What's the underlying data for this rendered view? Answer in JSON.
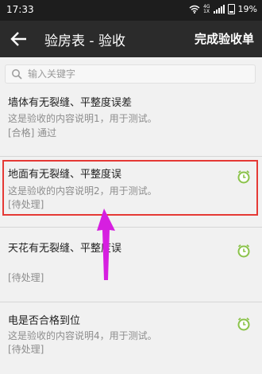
{
  "status_bar": {
    "time": "17:33",
    "network": "4G",
    "network_sub": "1X",
    "battery": "19%"
  },
  "app_bar": {
    "title": "验房表 - 验收",
    "action_label": "完成验收单"
  },
  "search": {
    "placeholder": "输入关键字"
  },
  "items": [
    {
      "title": "墙体有无裂缝、平整度误差",
      "desc": "这是验收的内容说明1，用于测试。",
      "status": "[合格] 通过"
    },
    {
      "title": "地面有无裂缝、平整度误",
      "desc": "这是验收的内容说明2，用于测试。",
      "status": "[待处理]"
    },
    {
      "title": "天花有无裂缝、平整度误",
      "desc": "",
      "status": "[待处理]"
    },
    {
      "title": "电是否合格到位",
      "desc": "这是验收的内容说明4，用于测试。",
      "status": "[待处理]"
    }
  ],
  "colors": {
    "highlight": "#e53935",
    "arrow": "#d61fe0",
    "clock": "#8bc34a"
  }
}
